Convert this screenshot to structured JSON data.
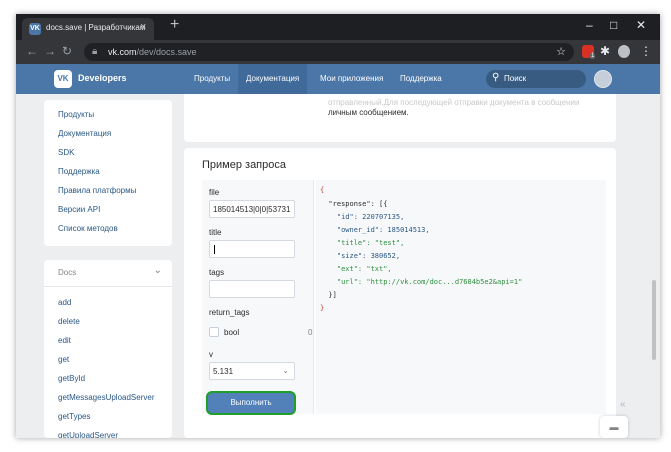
{
  "browser": {
    "tab_title": "docs.save | Разработчикам",
    "tab_icon": "vk-favicon",
    "new_tab": "+",
    "url_host": "vk.com",
    "url_path": "/dev/docs.save",
    "window_buttons": [
      "–",
      "□",
      "✕"
    ],
    "ext_badge": "1"
  },
  "header": {
    "brand": "Developers",
    "logo_text": "VK",
    "nav": [
      "Продукты",
      "Документация",
      "Мои приложения",
      "Поддержка"
    ],
    "active_nav": "Документация",
    "search_placeholder": "Поиск",
    "accent_color": "#4a76a8"
  },
  "sidebar": {
    "links": [
      "Продукты",
      "Документация",
      "SDK",
      "Поддержка",
      "Правила платформы",
      "Версии API",
      "Список методов"
    ],
    "docs_title": "Docs",
    "methods": [
      "add",
      "delete",
      "edit",
      "get",
      "getById",
      "getMessagesUploadServer",
      "getTypes",
      "getUploadServer"
    ]
  },
  "main": {
    "top_text_faded": "отправленный.Для последующей отправки документа в сообщении",
    "top_text": "личным сообщением.",
    "section_title": "Пример запроса",
    "form": {
      "file_label": "file",
      "file_value": "185014513|0|0|53731",
      "title_label": "title",
      "title_value": "",
      "tags_label": "tags",
      "tags_value": "",
      "return_tags_label": "return_tags",
      "bool_label": "bool",
      "bool_count": "0",
      "v_label": "v",
      "v_value": "5.131",
      "run_button": "Выполнить"
    },
    "response_lines": [
      "{",
      "  \"response\": [{",
      "    \"id\": 220707135,",
      "    \"owner_id\": 185014513,",
      "    \"title\": \"test\",",
      "    \"size\": 380652,",
      "    \"ext\": \"txt\",",
      "    \"url\": \"http://vk.com/doc...d7684b5e2&api=1\"",
      "  }]",
      "}"
    ]
  }
}
